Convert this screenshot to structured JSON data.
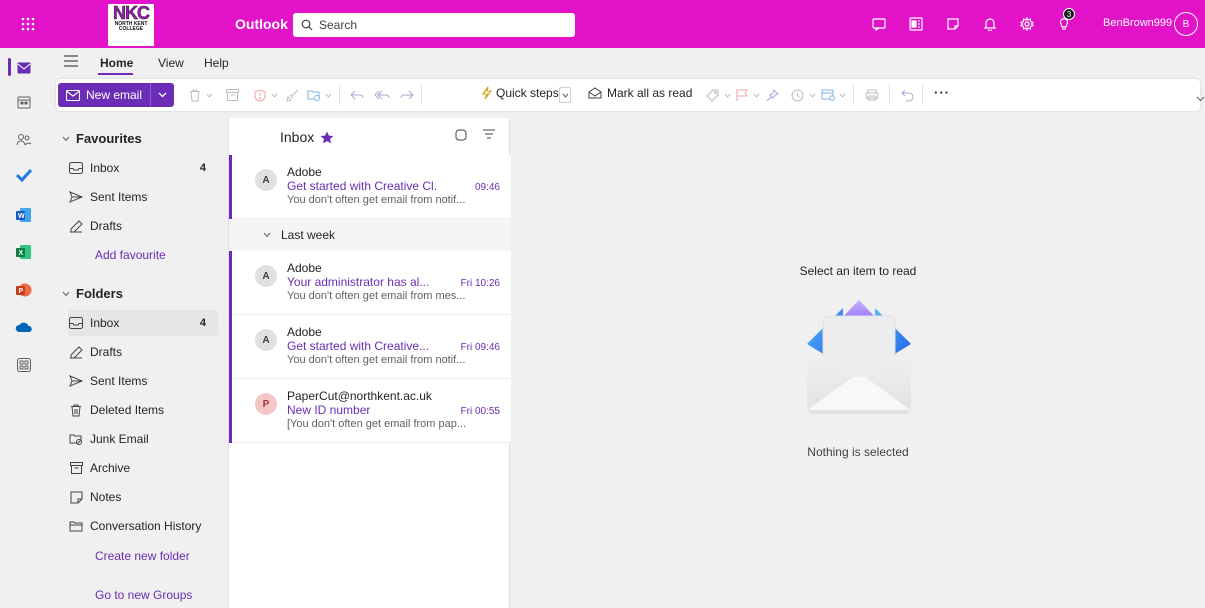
{
  "topbar": {
    "logo_big": "NKC",
    "logo_small_1": "NORTH KENT",
    "logo_small_2": "COLLEGE",
    "app_name": "Outlook",
    "search_placeholder": "Search",
    "notification_count": "3",
    "username": "BenBrown999",
    "avatar_initial": "B",
    "bg_color": "#e112c8"
  },
  "tabs": {
    "home": "Home",
    "view": "View",
    "help": "Help"
  },
  "ribbon": {
    "new_email": "New email",
    "quick_steps": "Quick steps",
    "mark_all_read": "Mark all as read",
    "more": "···"
  },
  "folders": {
    "favourites_label": "Favourites",
    "favourites": [
      {
        "label": "Inbox",
        "count": "4",
        "icon": "inbox-icon"
      },
      {
        "label": "Sent Items",
        "count": "",
        "icon": "send-icon"
      },
      {
        "label": "Drafts",
        "count": "",
        "icon": "drafts-icon"
      }
    ],
    "add_favourite": "Add favourite",
    "folders_label": "Folders",
    "items": [
      {
        "label": "Inbox",
        "count": "4",
        "icon": "inbox-icon"
      },
      {
        "label": "Drafts",
        "count": "",
        "icon": "drafts-icon"
      },
      {
        "label": "Sent Items",
        "count": "",
        "icon": "send-icon"
      },
      {
        "label": "Deleted Items",
        "count": "",
        "icon": "trash-icon"
      },
      {
        "label": "Junk Email",
        "count": "",
        "icon": "junk-icon"
      },
      {
        "label": "Archive",
        "count": "",
        "icon": "archive-icon"
      },
      {
        "label": "Notes",
        "count": "",
        "icon": "notes-icon"
      },
      {
        "label": "Conversation History",
        "count": "",
        "icon": "folder-icon"
      }
    ],
    "create_folder": "Create new folder",
    "go_groups": "Go to new Groups"
  },
  "message_list": {
    "title": "Inbox",
    "group_last_week": "Last week",
    "messages": [
      {
        "initial": "A",
        "sender": "Adobe",
        "subject": "Get started with Creative Cl...",
        "time": "09:46",
        "preview": "You don't often get email from notif..."
      },
      {
        "initial": "A",
        "sender": "Adobe",
        "subject": "Your administrator has al...",
        "time": "Fri 10:26",
        "preview": "You don't often get email from mes..."
      },
      {
        "initial": "A",
        "sender": "Adobe",
        "subject": "Get started with Creative...",
        "time": "Fri 09:46",
        "preview": "You don't often get email from notif..."
      },
      {
        "initial": "P",
        "sender": "PaperCut@northkent.ac.uk",
        "subject": "New ID number",
        "time": "Fri 00:55",
        "preview": "[You don't often get email from pap..."
      }
    ]
  },
  "reading_pane": {
    "title": "Select an item to read",
    "empty": "Nothing is selected"
  },
  "colors": {
    "accent": "#6b2cb6",
    "brand_bar": "#e112c8"
  }
}
